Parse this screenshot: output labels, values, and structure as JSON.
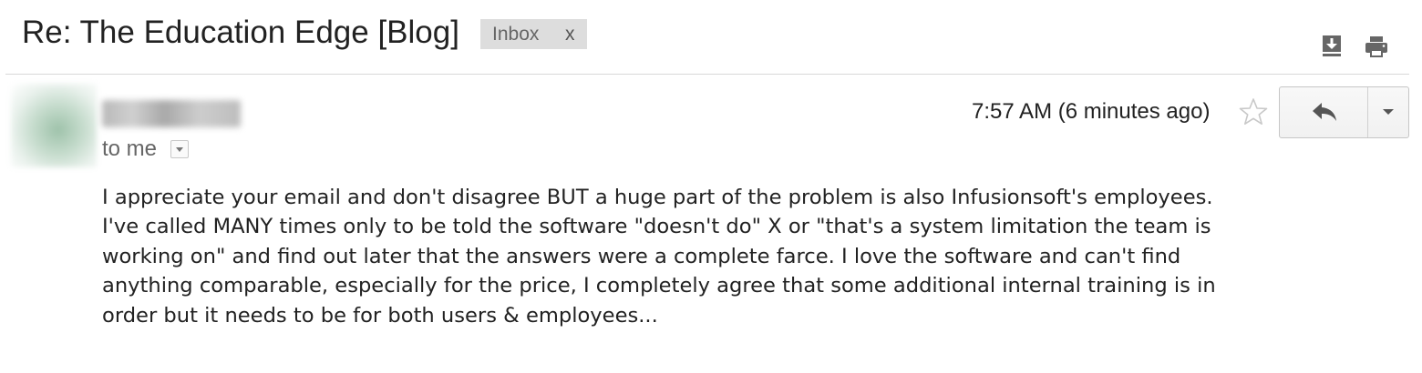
{
  "email": {
    "subject": "Re: The Education Edge [Blog]",
    "label": {
      "name": "Inbox",
      "remove": "x"
    },
    "recipient_line": "to me",
    "time": "7:57 AM (6 minutes ago)",
    "body_lines": [
      "I appreciate your email and don't disagree BUT a huge part of the problem is also Infusionsoft's employees.",
      "I've called MANY times only to be told the software \"doesn't do\" X or \"that's a system limitation the team is",
      "working on\" and find out later that the answers were a complete farce. I love the software and can't find",
      "anything comparable, especially for the price, I completely agree that some additional internal training is in",
      "order but it needs to be for both users & employees..."
    ]
  },
  "icons": {
    "download": "download-icon",
    "print": "print-icon",
    "star": "star-icon",
    "reply": "reply-icon",
    "more": "chevron-down-icon",
    "details": "chevron-down-icon"
  },
  "colors": {
    "label_bg": "#dddddd",
    "muted_text": "#666666",
    "divider": "#d8d8d8"
  }
}
